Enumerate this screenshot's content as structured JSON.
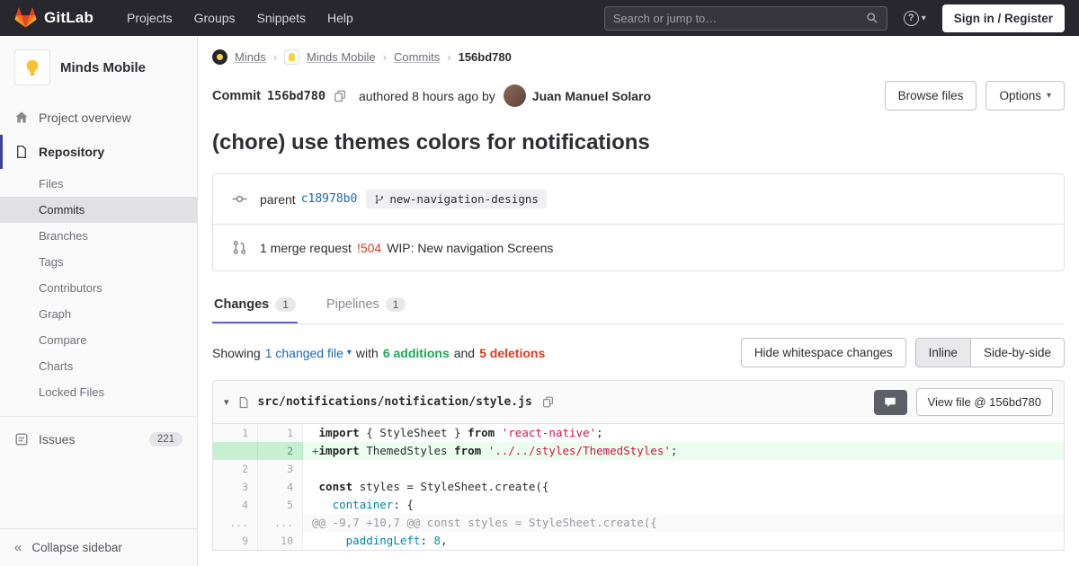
{
  "icons": {
    "caret_down": "▾",
    "breadcrumb_separator": "›",
    "collapse": "«",
    "question_mark": "?",
    "plus_marker": "+",
    "triangle_down": "▾"
  },
  "colors": {
    "brand_orange": "#e24329",
    "navbar_bg": "#28272d",
    "link_blue": "#1b69b6",
    "addition_green": "#1aaa55",
    "deletion_red": "#db3b21",
    "active_tab_indigo": "#6666c4",
    "sidebar_active_indigo": "#41419f"
  },
  "navbar": {
    "brand": "GitLab",
    "links": [
      {
        "label": "Projects"
      },
      {
        "label": "Groups"
      },
      {
        "label": "Snippets"
      },
      {
        "label": "Help"
      }
    ],
    "search_placeholder": "Search or jump to…",
    "sign_in_label": "Sign in / Register"
  },
  "sidebar": {
    "project_name": "Minds Mobile",
    "overview_label": "Project overview",
    "repository_label": "Repository",
    "repo_items": [
      {
        "label": "Files",
        "active": false
      },
      {
        "label": "Commits",
        "active": true
      },
      {
        "label": "Branches",
        "active": false
      },
      {
        "label": "Tags",
        "active": false
      },
      {
        "label": "Contributors",
        "active": false
      },
      {
        "label": "Graph",
        "active": false
      },
      {
        "label": "Compare",
        "active": false
      },
      {
        "label": "Charts",
        "active": false
      },
      {
        "label": "Locked Files",
        "active": false
      }
    ],
    "issues_label": "Issues",
    "issues_count": "221",
    "collapse_label": "Collapse sidebar"
  },
  "breadcrumb": {
    "items": [
      {
        "label": "Minds",
        "avatar": "minds",
        "current": false
      },
      {
        "label": "Minds Mobile",
        "avatar": "minds-mobile",
        "current": false
      },
      {
        "label": "Commits",
        "current": false
      },
      {
        "label": "156bd780",
        "current": true
      }
    ]
  },
  "commit": {
    "label": "Commit",
    "sha": "156bd780",
    "authored_text": "authored 8 hours ago by",
    "author_name": "Juan Manuel Solaro",
    "browse_files_label": "Browse files",
    "options_label": "Options",
    "title": "(chore) use themes colors for notifications",
    "parent_label": "parent",
    "parent_sha": "c18978b0",
    "branch_name": "new-navigation-designs",
    "mr_count_text": "1 merge request",
    "mr_ref": "!504",
    "mr_title": "WIP: New navigation Screens"
  },
  "tabs": [
    {
      "label": "Changes",
      "count": "1",
      "active": true
    },
    {
      "label": "Pipelines",
      "count": "1",
      "active": false
    }
  ],
  "diff_toolbar": {
    "showing_label": "Showing",
    "changed_files_label": "1 changed file",
    "with_label": "with",
    "additions_label": "6 additions",
    "and_label": "and",
    "deletions_label": "5 deletions",
    "hide_whitespace_label": "Hide whitespace changes",
    "inline_label": "Inline",
    "side_by_side_label": "Side-by-side"
  },
  "diff_file": {
    "path": "src/notifications/notification/style.js",
    "view_file_label": "View file @ 156bd780",
    "lines": [
      {
        "old": "1",
        "new": "1",
        "type": "normal",
        "segments": [
          {
            "t": "import",
            "c": "k"
          },
          {
            "t": " { StyleSheet } ",
            "c": ""
          },
          {
            "t": "from",
            "c": "k"
          },
          {
            "t": " ",
            "c": ""
          },
          {
            "t": "'react-native'",
            "c": "s"
          },
          {
            "t": ";",
            "c": ""
          }
        ]
      },
      {
        "old": "",
        "new": "2",
        "type": "add",
        "segments": [
          {
            "t": "import",
            "c": "k"
          },
          {
            "t": " ThemedStyles ",
            "c": ""
          },
          {
            "t": "from",
            "c": "k"
          },
          {
            "t": " ",
            "c": ""
          },
          {
            "t": "'../../styles/ThemedStyles'",
            "c": "s"
          },
          {
            "t": ";",
            "c": ""
          }
        ]
      },
      {
        "old": "2",
        "new": "3",
        "type": "normal",
        "segments": []
      },
      {
        "old": "3",
        "new": "4",
        "type": "normal",
        "segments": [
          {
            "t": "const",
            "c": "k"
          },
          {
            "t": " styles = StyleSheet.create({",
            "c": ""
          }
        ]
      },
      {
        "old": "4",
        "new": "5",
        "type": "normal",
        "segments": [
          {
            "t": "  ",
            "c": ""
          },
          {
            "t": "container",
            "c": "nl"
          },
          {
            "t": ": {",
            "c": ""
          }
        ]
      },
      {
        "old": "...",
        "new": "...",
        "type": "match",
        "segments": [
          {
            "t": "@@ -9,7 +10,7 @@ const styles = StyleSheet.create({",
            "c": ""
          }
        ]
      },
      {
        "old": "9",
        "new": "10",
        "type": "normal",
        "segments": [
          {
            "t": "    ",
            "c": ""
          },
          {
            "t": "paddingLeft",
            "c": "nl"
          },
          {
            "t": ": ",
            "c": ""
          },
          {
            "t": "8",
            "c": "mi"
          },
          {
            "t": ",",
            "c": ""
          }
        ]
      }
    ]
  }
}
